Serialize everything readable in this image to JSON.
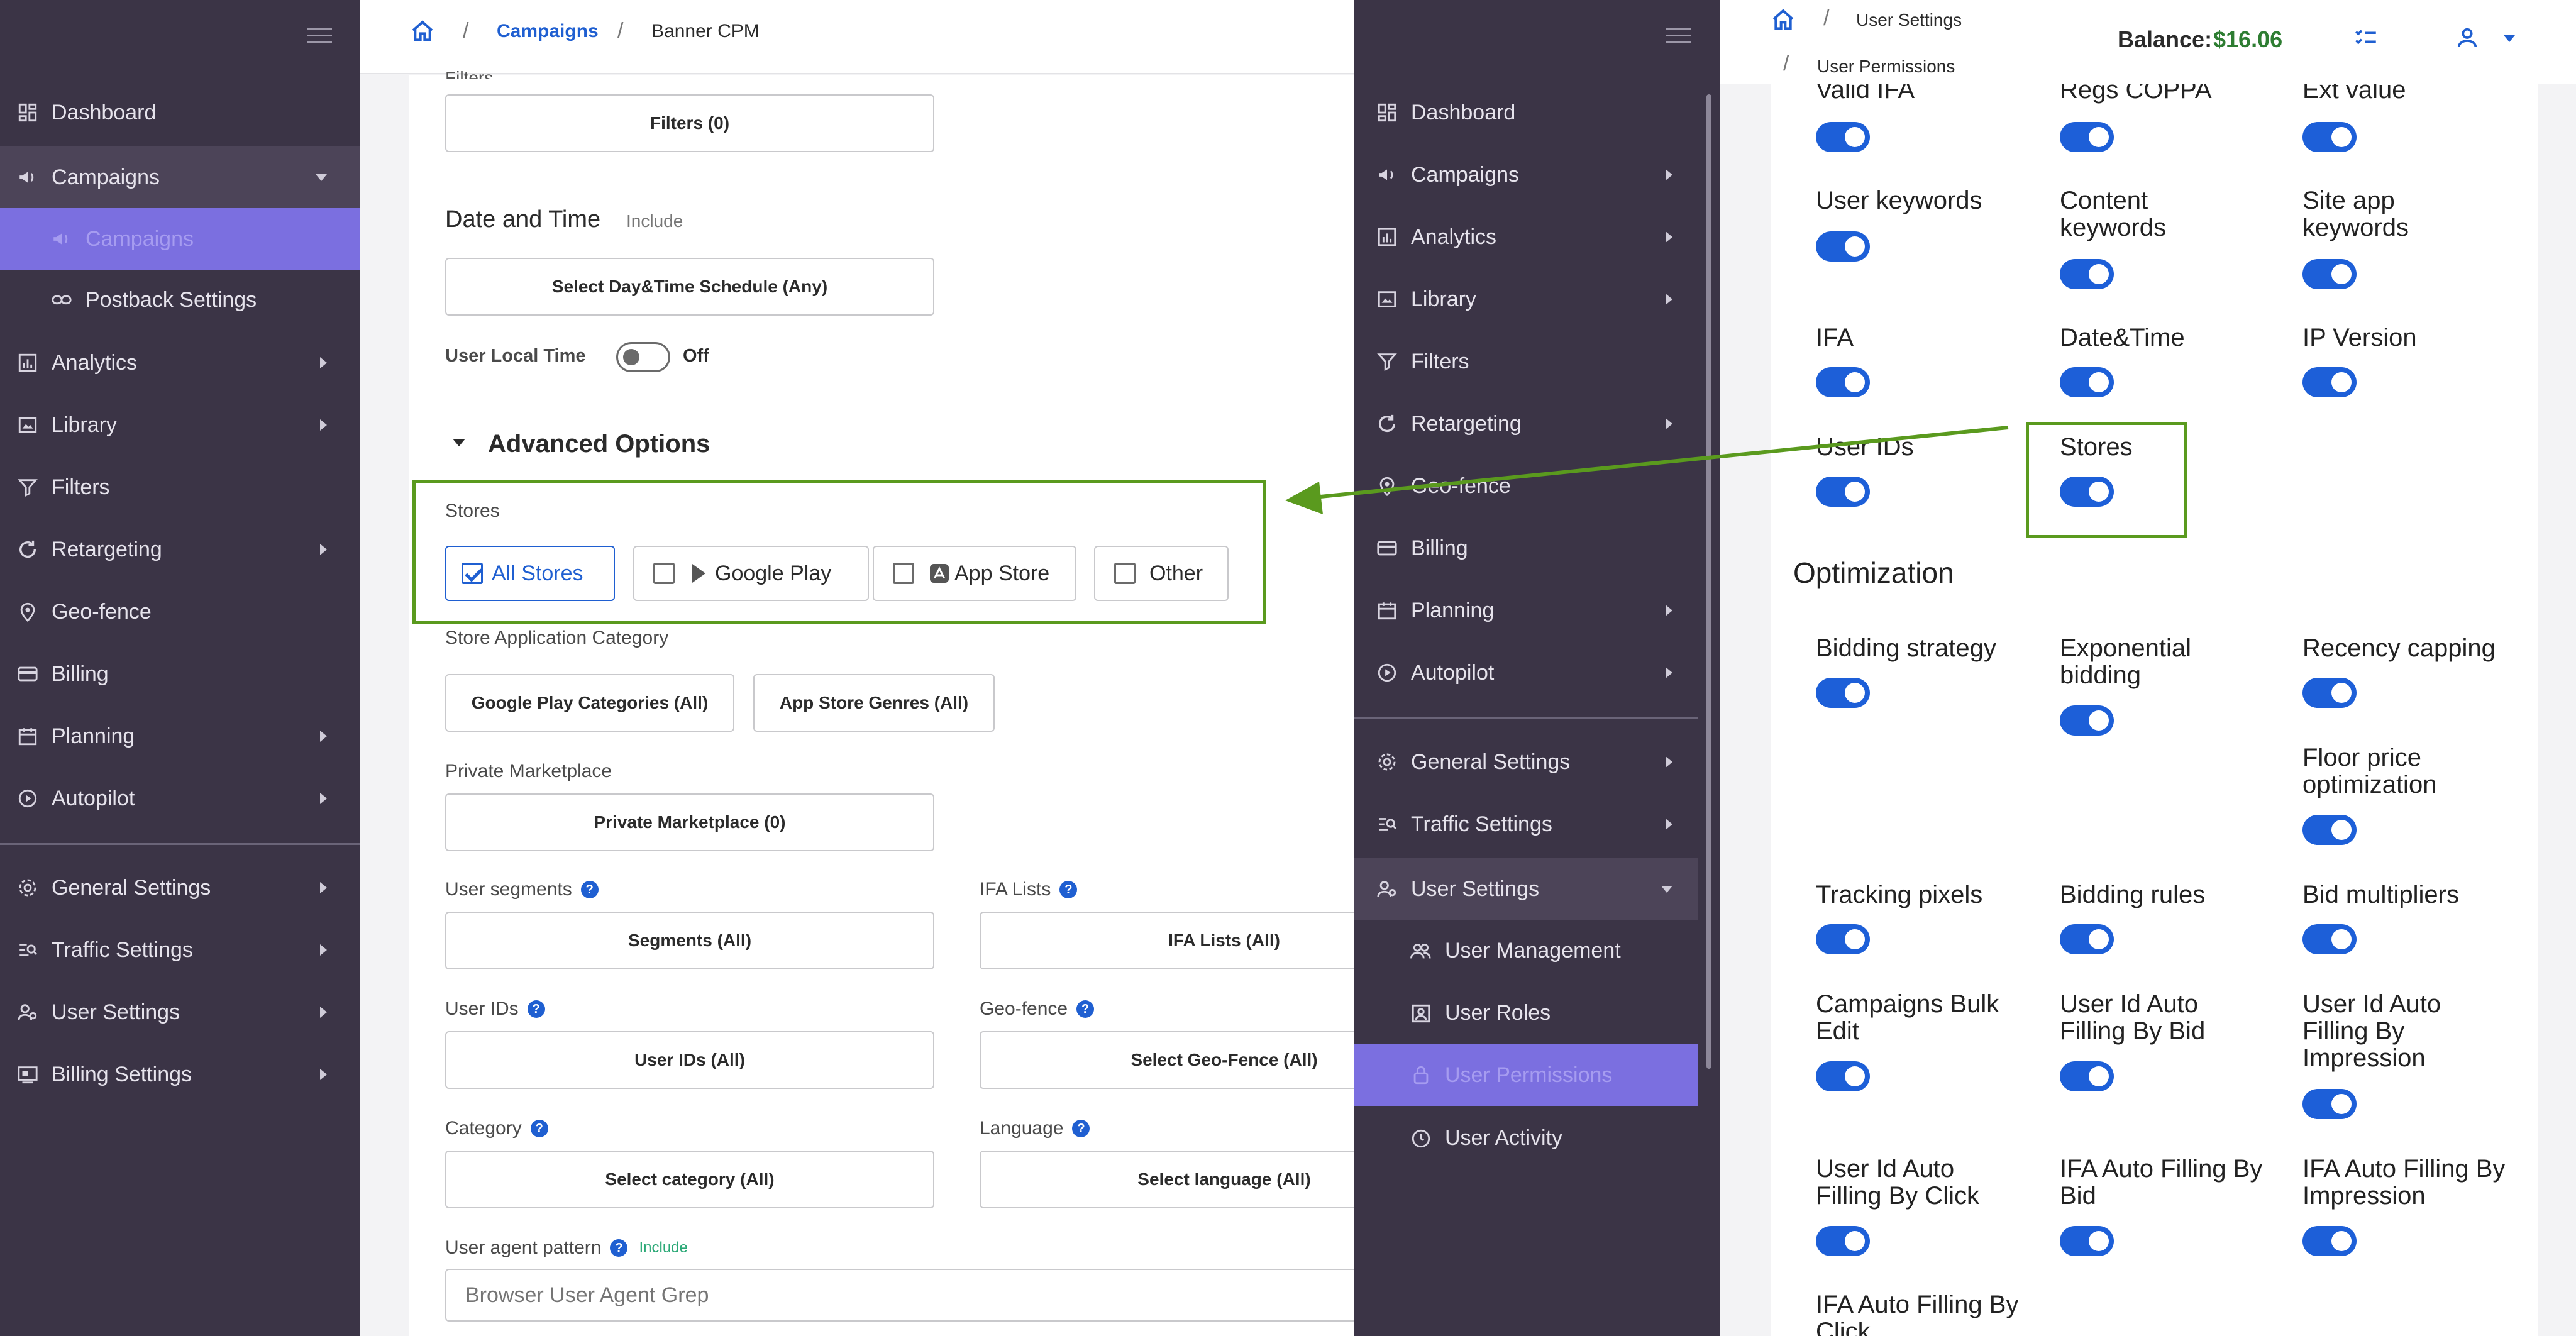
{
  "left_sidebar": {
    "items": [
      {
        "label": "Dashboard",
        "icon": "dashboard-icon"
      },
      {
        "label": "Campaigns",
        "icon": "megaphone-icon"
      },
      {
        "label": "Campaigns",
        "icon": "megaphone-icon"
      },
      {
        "label": "Postback Settings",
        "icon": "link-icon"
      },
      {
        "label": "Analytics",
        "icon": "chart-icon"
      },
      {
        "label": "Library",
        "icon": "library-icon"
      },
      {
        "label": "Filters",
        "icon": "funnel-icon"
      },
      {
        "label": "Retargeting",
        "icon": "refresh-icon"
      },
      {
        "label": "Geo-fence",
        "icon": "pin-icon"
      },
      {
        "label": "Billing",
        "icon": "card-icon"
      },
      {
        "label": "Planning",
        "icon": "calendar-icon"
      },
      {
        "label": "Autopilot",
        "icon": "play-icon"
      },
      {
        "label": "General Settings",
        "icon": "gear-icon"
      },
      {
        "label": "Traffic Settings",
        "icon": "traffic-icon"
      },
      {
        "label": "User Settings",
        "icon": "users-icon"
      },
      {
        "label": "Billing Settings",
        "icon": "billing-icon"
      }
    ]
  },
  "left_header": {
    "breadcrumb": [
      "Campaigns",
      "Banner CPM"
    ]
  },
  "campaign_form": {
    "filters_partial_label": "Filters",
    "filters_button": "Filters (0)",
    "date_time_title": "Date and Time",
    "date_time_include": "Include",
    "schedule_button": "Select Day&Time Schedule (Any)",
    "user_local_time_label": "User Local Time",
    "user_local_time_state": "Off",
    "advanced_options_title": "Advanced Options",
    "stores_label": "Stores",
    "stores": [
      {
        "label": "All Stores",
        "checked": true
      },
      {
        "label": "Google Play",
        "checked": false
      },
      {
        "label": "App Store",
        "checked": false
      },
      {
        "label": "Other",
        "checked": false
      }
    ],
    "store_app_category_label": "Store Application Category",
    "google_play_categories_button": "Google Play Categories (All)",
    "app_store_genres_button": "App Store Genres (All)",
    "private_marketplace_label": "Private Marketplace",
    "private_marketplace_button": "Private Marketplace (0)",
    "user_segments_label": "User segments",
    "segments_button": "Segments (All)",
    "ifa_lists_label": "IFA Lists",
    "ifa_lists_button": "IFA Lists (All)",
    "user_ids_label": "User IDs",
    "user_ids_button": "User IDs (All)",
    "geo_fence_label": "Geo-fence",
    "geo_fence_button": "Select Geo-Fence (All)",
    "category_label": "Category",
    "category_button": "Select category (All)",
    "language_label": "Language",
    "language_button": "Select language (All)",
    "user_agent_label": "User agent pattern",
    "user_agent_include": "Include",
    "user_agent_placeholder": "Browser User Agent Grep"
  },
  "mid_sidebar": {
    "items": [
      {
        "label": "Dashboard",
        "icon": "dashboard-icon"
      },
      {
        "label": "Campaigns",
        "icon": "megaphone-icon"
      },
      {
        "label": "Analytics",
        "icon": "chart-icon"
      },
      {
        "label": "Library",
        "icon": "library-icon"
      },
      {
        "label": "Filters",
        "icon": "funnel-icon"
      },
      {
        "label": "Retargeting",
        "icon": "refresh-icon"
      },
      {
        "label": "Geo-fence",
        "icon": "pin-icon"
      },
      {
        "label": "Billing",
        "icon": "card-icon"
      },
      {
        "label": "Planning",
        "icon": "calendar-icon"
      },
      {
        "label": "Autopilot",
        "icon": "play-icon"
      },
      {
        "label": "General Settings",
        "icon": "gear-icon"
      },
      {
        "label": "Traffic Settings",
        "icon": "traffic-icon"
      },
      {
        "label": "User Settings",
        "icon": "users-icon"
      },
      {
        "label": "User Management",
        "icon": "user-management-icon"
      },
      {
        "label": "User Roles",
        "icon": "user-roles-icon"
      },
      {
        "label": "User Permissions",
        "icon": "lock-icon"
      },
      {
        "label": "User Activity",
        "icon": "clock-icon"
      }
    ]
  },
  "right_header": {
    "breadcrumb_1": "User Settings",
    "breadcrumb_2": "User Permissions",
    "balance_label": "Balance:",
    "balance_value": "$16.06"
  },
  "permissions": {
    "top_row": [
      "Valid IFA",
      "Regs COPPA",
      "Ext value"
    ],
    "user_keywords": "User keywords",
    "content_keywords": "Content keywords",
    "site_app_keywords": "Site app keywords",
    "ifa": "IFA",
    "date_time": "Date&Time",
    "ip_version": "IP Version",
    "user_ids": "User IDs",
    "stores": "Stores",
    "optimization_title": "Optimization",
    "bidding_strategy": "Bidding strategy",
    "exponential_bidding": "Exponential bidding",
    "recency_capping": "Recency capping",
    "floor_price_optimization": "Floor price optimization",
    "tracking_pixels": "Tracking pixels",
    "bidding_rules": "Bidding rules",
    "bid_multipliers": "Bid multipliers",
    "campaigns_bulk_edit": "Campaigns Bulk Edit",
    "uid_auto_bid": "User Id Auto Filling By Bid",
    "uid_auto_impression": "User Id Auto Filling By Impression",
    "uid_auto_click": "User Id Auto Filling By Click",
    "ifa_auto_bid": "IFA Auto Filling By Bid",
    "ifa_auto_impression": "IFA Auto Filling By Impression",
    "ifa_auto_click": "IFA Auto Filling By Click"
  },
  "colors": {
    "sidebar_bg": "#3b3446",
    "sidebar_active": "#7b6fe0",
    "toggle_on": "#1d5fd8",
    "highlight_green": "#5a9a1e",
    "link_blue": "#1f5fd1",
    "balance_green": "#2e7d32"
  }
}
